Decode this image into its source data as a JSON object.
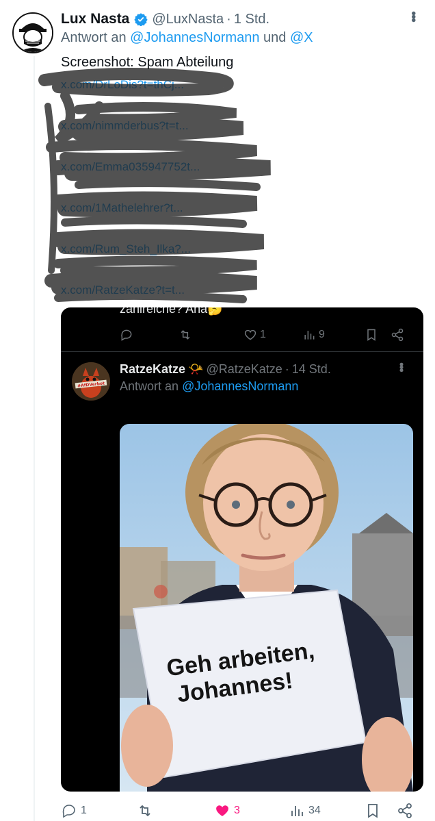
{
  "tweet": {
    "author_name": "Lux Nasta",
    "author_handle": "@LuxNasta",
    "separator": "·",
    "time": "1 Std.",
    "reply_prefix": "Antwort an",
    "reply_to_1": "@JohannesNormann",
    "reply_and": "und",
    "reply_to_2": "@X",
    "text": "Screenshot: Spam Abteilung",
    "links": [
      "x.com/DrLoDis?t=thCj...",
      "x.com/nimmderbus?t=t...",
      "x.com/Emma035947752t...",
      "x.com/1Mathelehrer?t...",
      "x.com/Rum_Steh_Ilka?...",
      "x.com/RatzeKatze?t=t..."
    ],
    "actions": {
      "replies": "1",
      "retweets": "",
      "likes": "3",
      "views": "34"
    }
  },
  "quoted": {
    "cut_text": "zahlreiche? Aha🤔",
    "actions": {
      "replies": "",
      "retweets": "",
      "likes": "1",
      "views": "9"
    },
    "author_name": "RatzeKatze",
    "author_emoji": "📯",
    "author_handle": "@RatzeKatze",
    "separator": "·",
    "time": "14 Std.",
    "reply_prefix": "Antwort an",
    "reply_to": "@JohannesNormann",
    "avatar_text": "#AfDVerbot",
    "image": {
      "sign_line1": "Geh arbeiten,",
      "sign_line2": "Johannes!"
    }
  },
  "colors": {
    "accent": "#1d9bf0",
    "like": "#f91880",
    "muted": "#536471",
    "dark_bg": "#000000"
  }
}
